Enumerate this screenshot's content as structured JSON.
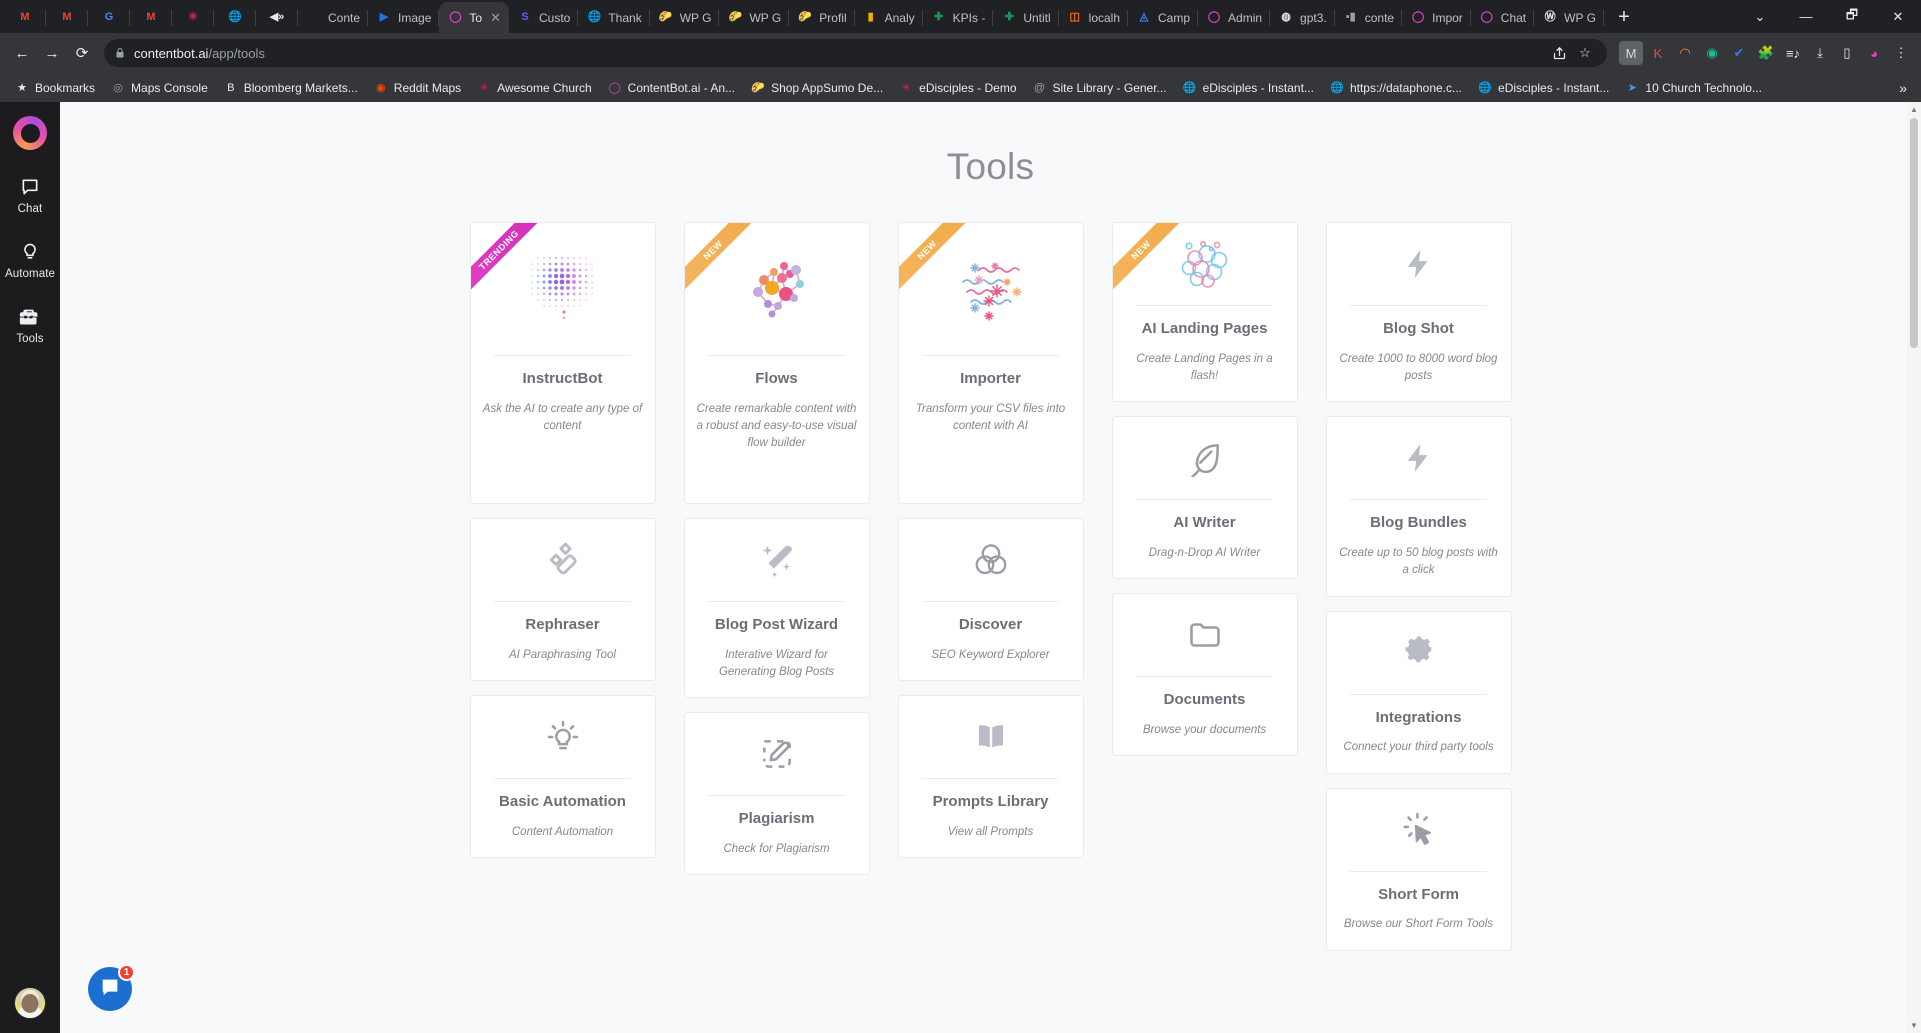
{
  "browser": {
    "pinned_tabs": [
      {
        "icon": "gmail-icon",
        "glyph": "M",
        "color": "#ea4335"
      },
      {
        "icon": "gmail-icon",
        "glyph": "M",
        "color": "#ea4335"
      },
      {
        "icon": "google-icon",
        "glyph": "G",
        "color": "#4285f4"
      },
      {
        "icon": "gmail-icon",
        "glyph": "M",
        "color": "#ea4335"
      },
      {
        "icon": "slack-icon",
        "glyph": "✳",
        "color": "#e01e5a"
      },
      {
        "icon": "globe-icon",
        "glyph": "🌐",
        "color": "#9aa0a6"
      },
      {
        "icon": "speaker-icon",
        "glyph": "◀»",
        "color": "#e8eaed"
      }
    ],
    "tabs": [
      {
        "title": "Conte",
        "icon": "page-icon",
        "glyph": "",
        "color": "#9aa0a6",
        "active": false
      },
      {
        "title": "Image",
        "icon": "image-icon",
        "glyph": "▶",
        "color": "#1a73e8",
        "active": false
      },
      {
        "title": "To",
        "icon": "contentbot-icon",
        "glyph": "◯",
        "color": "#e341c6",
        "active": true
      },
      {
        "title": "Custo",
        "icon": "stripe-icon",
        "glyph": "S",
        "color": "#635bff",
        "active": false
      },
      {
        "title": "Thank",
        "icon": "globe-icon",
        "glyph": "🌐",
        "color": "#9aa0a6",
        "active": false
      },
      {
        "title": "WP G",
        "icon": "taco-icon",
        "glyph": "🌮",
        "color": "#f5b93c",
        "active": false
      },
      {
        "title": "WP G",
        "icon": "taco-icon",
        "glyph": "🌮",
        "color": "#f5b93c",
        "active": false
      },
      {
        "title": "Profil",
        "icon": "taco-icon",
        "glyph": "🌮",
        "color": "#f5b93c",
        "active": false
      },
      {
        "title": "Analy",
        "icon": "analytics-icon",
        "glyph": "▮",
        "color": "#f9ab00",
        "active": false
      },
      {
        "title": "KPIs -",
        "icon": "sheets-icon",
        "glyph": "✚",
        "color": "#0f9d58",
        "active": false
      },
      {
        "title": "Untitl",
        "icon": "sheets-icon",
        "glyph": "✚",
        "color": "#0f9d58",
        "active": false
      },
      {
        "title": "localh",
        "icon": "localhost-icon",
        "glyph": "◫",
        "color": "#ff6a00",
        "active": false
      },
      {
        "title": "Camp",
        "icon": "google-ads-icon",
        "glyph": "◬",
        "color": "#4285f4",
        "active": false
      },
      {
        "title": "Admin",
        "icon": "contentbot-icon",
        "glyph": "◯",
        "color": "#e341c6",
        "active": false
      },
      {
        "title": "gpt3.",
        "icon": "github-icon",
        "glyph": "◍",
        "color": "#e8eaed",
        "active": false
      },
      {
        "title": "conte",
        "icon": "video-icon",
        "glyph": "▪▮",
        "color": "#9aa0a6",
        "active": false
      },
      {
        "title": "Impor",
        "icon": "contentbot-icon",
        "glyph": "◯",
        "color": "#e341c6",
        "active": false
      },
      {
        "title": "Chat",
        "icon": "contentbot-icon",
        "glyph": "◯",
        "color": "#e341c6",
        "active": false
      },
      {
        "title": "WP G",
        "icon": "wordpress-icon",
        "glyph": "Ⓦ",
        "color": "#e8eaed",
        "active": false
      }
    ],
    "new_tab_label": "+",
    "window_controls": [
      "⌄",
      "—",
      "🗗",
      "✕"
    ],
    "nav": {
      "back": "←",
      "forward": "→",
      "reload": "⟳",
      "lock_icon": "lock-icon",
      "url_host": "contentbot.ai",
      "url_path": "/app/tools",
      "share_icon": "share-icon",
      "bookmark_star": "☆"
    },
    "toolbar_icons": [
      {
        "name": "gmail-extension-icon",
        "glyph": "M",
        "color": "#d9d9d9",
        "bg": "#5f6368"
      },
      {
        "name": "k-extension-icon",
        "glyph": "K",
        "color": "#e5484d",
        "bg": "transparent"
      },
      {
        "name": "honey-extension-icon",
        "glyph": "◠",
        "color": "#ff8f1f",
        "bg": "transparent"
      },
      {
        "name": "grammarly-extension-icon",
        "glyph": "◉",
        "color": "#15c39a",
        "bg": "transparent"
      },
      {
        "name": "check-extension-icon",
        "glyph": "✔",
        "color": "#2b7de9",
        "bg": "transparent"
      },
      {
        "name": "extensions-puzzle-icon",
        "glyph": "🧩",
        "color": "#e8eaed",
        "bg": "transparent"
      },
      {
        "name": "reading-list-icon",
        "glyph": "≡♪",
        "color": "#e8eaed",
        "bg": "transparent"
      },
      {
        "name": "downloads-icon",
        "glyph": "⤓",
        "color": "#e8eaed",
        "bg": "transparent"
      },
      {
        "name": "sidepanel-icon",
        "glyph": "▯",
        "color": "#e8eaed",
        "bg": "transparent"
      },
      {
        "name": "profile-avatar-icon",
        "glyph": "◕",
        "color": "#e341c6",
        "bg": "transparent"
      },
      {
        "name": "chrome-menu-icon",
        "glyph": "⋮",
        "color": "#e8eaed",
        "bg": "transparent"
      }
    ],
    "bookmarks": [
      {
        "label": "Bookmarks",
        "icon": "star-icon",
        "glyph": "★",
        "color": "#e8eaed"
      },
      {
        "label": "Maps Console",
        "icon": "maps-icon",
        "glyph": "◎",
        "color": "#9aa0a6"
      },
      {
        "label": "Bloomberg Markets...",
        "icon": "bloomberg-icon",
        "glyph": "B",
        "color": "#e8eaed"
      },
      {
        "label": "Reddit Maps",
        "icon": "reddit-icon",
        "glyph": "◉",
        "color": "#ff4500"
      },
      {
        "label": "Awesome Church",
        "icon": "slack-icon",
        "glyph": "✳",
        "color": "#e01e5a"
      },
      {
        "label": "ContentBot.ai - An...",
        "icon": "contentbot-icon",
        "glyph": "◯",
        "color": "#e341c6"
      },
      {
        "label": "Shop AppSumo De...",
        "icon": "taco-icon",
        "glyph": "🌮",
        "color": "#f5b93c"
      },
      {
        "label": "eDisciples - Demo",
        "icon": "slack-icon",
        "glyph": "✳",
        "color": "#e01e5a"
      },
      {
        "label": "Site Library - Gener...",
        "icon": "at-icon",
        "glyph": "@",
        "color": "#9aa0a6"
      },
      {
        "label": "eDisciples - Instant...",
        "icon": "globe-icon",
        "glyph": "🌐",
        "color": "#e8eaed"
      },
      {
        "label": "https://dataphone.c...",
        "icon": "globe-icon",
        "glyph": "🌐",
        "color": "#e8eaed"
      },
      {
        "label": "eDisciples - Instant...",
        "icon": "globe-icon",
        "glyph": "🌐",
        "color": "#e8eaed"
      },
      {
        "label": "10 Church Technolo...",
        "icon": "paper-plane-icon",
        "glyph": "➤",
        "color": "#4e8ef7"
      }
    ],
    "bookmarks_overflow": "»"
  },
  "sidebar": {
    "logo_name": "contentbot-logo",
    "items": [
      {
        "label": "Chat",
        "icon": "chat-bubble-icon"
      },
      {
        "label": "Automate",
        "icon": "lightbulb-icon"
      },
      {
        "label": "Tools",
        "icon": "toolbox-icon"
      }
    ],
    "avatar_name": "user-avatar"
  },
  "main": {
    "page_title": "Tools",
    "columns": [
      {
        "cards": [
          {
            "title": "InstructBot",
            "desc": "Ask the AI to create any type of content",
            "icon": "dot-matrix-brain-icon",
            "ribbon": {
              "label": "TRENDING",
              "color": "pink"
            },
            "size": "tall"
          },
          {
            "title": "Rephraser",
            "desc": "AI Paraphrasing Tool",
            "icon": "magic-wand-icon",
            "ribbon": null,
            "size": "reg"
          },
          {
            "title": "Basic Automation",
            "desc": "Content Automation",
            "icon": "lightbulb-ray-icon",
            "ribbon": null,
            "size": "reg"
          }
        ]
      },
      {
        "cards": [
          {
            "title": "Flows",
            "desc": "Create remarkable content with a robust and easy-to-use visual flow builder",
            "icon": "neural-network-brain-icon",
            "ribbon": {
              "label": "NEW",
              "color": "orange"
            },
            "size": "tall"
          },
          {
            "title": "Blog Post Wizard",
            "desc": "Interative Wizard for Generating Blog Posts",
            "icon": "sparkle-wand-icon",
            "ribbon": null,
            "size": "reg"
          },
          {
            "title": "Plagiarism",
            "desc": "Check for Plagiarism",
            "icon": "dashed-pencil-icon",
            "ribbon": null,
            "size": "reg"
          }
        ]
      },
      {
        "cards": [
          {
            "title": "Importer",
            "desc": "Transform your CSV files into content with AI",
            "icon": "squiggle-sparkle-icon",
            "ribbon": {
              "label": "NEW",
              "color": "orange"
            },
            "size": "tall"
          },
          {
            "title": "Discover",
            "desc": "SEO Keyword Explorer",
            "icon": "venn-diagram-icon",
            "ribbon": null,
            "size": "reg"
          },
          {
            "title": "Prompts Library",
            "desc": "View all Prompts",
            "icon": "open-book-icon",
            "ribbon": null,
            "size": "reg"
          }
        ]
      },
      {
        "cards": [
          {
            "title": "AI Landing Pages",
            "desc": "Create Landing Pages in a flash!",
            "icon": "bubble-cluster-icon",
            "ribbon": {
              "label": "NEW",
              "color": "orange"
            },
            "size": "mid"
          },
          {
            "title": "AI Writer",
            "desc": "Drag-n-Drop AI Writer",
            "icon": "feather-quill-icon",
            "ribbon": null,
            "size": "mid"
          },
          {
            "title": "Documents",
            "desc": "Browse your documents",
            "icon": "folder-icon",
            "ribbon": null,
            "size": "reg"
          }
        ]
      },
      {
        "cards": [
          {
            "title": "Blog Shot",
            "desc": "Create 1000 to 8000 word blog posts",
            "icon": "lightning-bolt-icon",
            "ribbon": null,
            "size": "mid"
          },
          {
            "title": "Blog Bundles",
            "desc": "Create up to 50 blog posts with a click",
            "icon": "lightning-bolt-icon",
            "ribbon": null,
            "size": "mid"
          },
          {
            "title": "Integrations",
            "desc": "Connect your third party tools",
            "icon": "gear-icon",
            "ribbon": null,
            "size": "reg"
          },
          {
            "title": "Short Form",
            "desc": "Browse our Short Form Tools",
            "icon": "cursor-click-icon",
            "ribbon": null,
            "size": "reg"
          }
        ]
      }
    ]
  },
  "intercom": {
    "icon": "intercom-chat-icon",
    "badge_count": "1"
  },
  "colors": {
    "accent_pink": "#e341c6",
    "accent_orange": "#f5b760",
    "card_title": "#6b6e78",
    "page_bg": "#f8f9fb"
  }
}
